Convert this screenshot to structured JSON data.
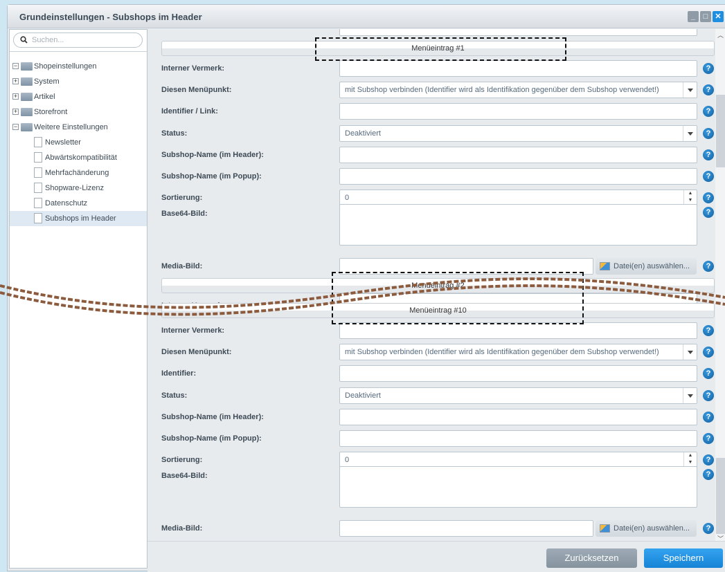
{
  "window": {
    "title": "Grundeinstellungen - Subshops im Header",
    "minimize": "_",
    "maximize": "□",
    "close": "✕"
  },
  "tree": {
    "search_placeholder": "Suchen...",
    "items": [
      {
        "label": "Shopeinstellungen",
        "type": "folder",
        "expander": "−",
        "level": 0
      },
      {
        "label": "System",
        "type": "folder",
        "expander": "+",
        "level": 0
      },
      {
        "label": "Artikel",
        "type": "folder",
        "expander": "+",
        "level": 0
      },
      {
        "label": "Storefront",
        "type": "folder",
        "expander": "+",
        "level": 0
      },
      {
        "label": "Weitere Einstellungen",
        "type": "folder",
        "expander": "−",
        "level": 0
      },
      {
        "label": "Newsletter",
        "type": "leaf",
        "level": 1
      },
      {
        "label": "Abwärtskompatibilität",
        "type": "leaf",
        "level": 1
      },
      {
        "label": "Mehrfachänderung",
        "type": "leaf",
        "level": 1
      },
      {
        "label": "Shopware-Lizenz",
        "type": "leaf",
        "level": 1
      },
      {
        "label": "Datenschutz",
        "type": "leaf",
        "level": 1
      },
      {
        "label": "Subshops im Header",
        "type": "leaf",
        "level": 1,
        "selected": true
      }
    ]
  },
  "sections": [
    {
      "header": "Menüeintrag #1",
      "fields": [
        {
          "label": "Interner Vermerk:",
          "type": "text",
          "value": ""
        },
        {
          "label": "Diesen Menüpunkt:",
          "type": "combo",
          "value": "mit Subshop verbinden (Identifier wird als Identifikation gegenüber dem Subshop verwendet!)"
        },
        {
          "label": "Identifier / Link:",
          "type": "text",
          "value": ""
        },
        {
          "label": "Status:",
          "type": "combo",
          "value": "Deaktiviert"
        },
        {
          "label": "Subshop-Name (im Header):",
          "type": "text",
          "value": ""
        },
        {
          "label": "Subshop-Name (im Popup):",
          "type": "text",
          "value": ""
        },
        {
          "label": "Sortierung:",
          "type": "spin",
          "value": "0"
        },
        {
          "label": "Base64-Bild:",
          "type": "textarea",
          "value": ""
        },
        {
          "label": "Media-Bild:",
          "type": "media",
          "value": "",
          "button": "Datei(en) auswählen..."
        }
      ]
    },
    {
      "header": "Menüeintrag #2"
    },
    {
      "header": "Menüeintrag #10",
      "fields": [
        {
          "label": "Interner Vermerk:",
          "type": "text",
          "value": ""
        },
        {
          "label": "Diesen Menüpunkt:",
          "type": "combo",
          "value": "mit Subshop verbinden (Identifier wird als Identifikation gegenüber dem Subshop verwendet!)"
        },
        {
          "label": "Identifier:",
          "type": "text",
          "value": ""
        },
        {
          "label": "Status:",
          "type": "combo",
          "value": "Deaktiviert"
        },
        {
          "label": "Subshop-Name (im Header):",
          "type": "text",
          "value": ""
        },
        {
          "label": "Subshop-Name (im Popup):",
          "type": "text",
          "value": ""
        },
        {
          "label": "Sortierung:",
          "type": "spin",
          "value": "0"
        },
        {
          "label": "Base64-Bild:",
          "type": "textarea",
          "value": ""
        },
        {
          "label": "Media-Bild:",
          "type": "media",
          "value": "",
          "button": "Datei(en) auswählen..."
        }
      ]
    }
  ],
  "overlap_label": "Interner Vermerk:",
  "help_glyph": "?",
  "footer": {
    "reset": "Zurücksetzen",
    "save": "Speichern"
  },
  "colors": {
    "save": "#1e8fe0",
    "reset": "#8d9ba8",
    "cut_line": "#8c5a3c"
  }
}
